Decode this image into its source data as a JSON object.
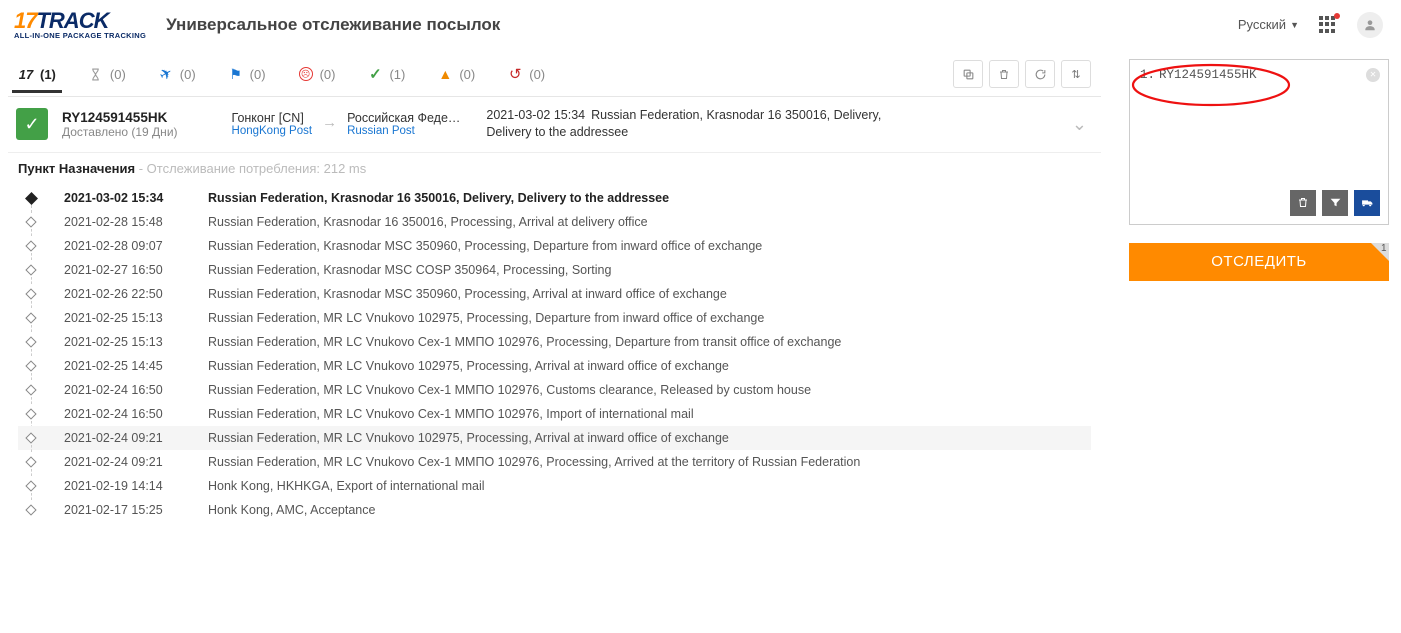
{
  "header": {
    "logo_17": "17",
    "logo_track": "TRACK",
    "logo_sub": "ALL-IN-ONE PACKAGE TRACKING",
    "title": "Универсальное отслеживание посылок",
    "language": "Русский"
  },
  "tabs": {
    "all": "(1)",
    "pending": "(0)",
    "transit": "(0)",
    "flag": "(0)",
    "alert": "(0)",
    "delivered": "(1)",
    "warning": "(0)",
    "returned": "(0)"
  },
  "summary": {
    "tracking_no": "RY124591455HK",
    "status_sub": "Доставлено (19 Дни)",
    "origin_country": "Гонконг [CN]",
    "origin_carrier": "HongKong Post",
    "dest_country": "Российская Феде…",
    "dest_carrier": "Russian Post",
    "latest_dt": "2021-03-02 15:34",
    "latest_text": "Russian Federation, Krasnodar 16 350016, Delivery, Delivery to the addressee"
  },
  "dest": {
    "label": "Пункт Назначения",
    "meta": " - Отслеживание потребления: 212 ms"
  },
  "events": [
    {
      "dt": "2021-03-02 15:34",
      "text": "Russian Federation, Krasnodar 16 350016, Delivery, Delivery to the addressee",
      "first": true
    },
    {
      "dt": "2021-02-28 15:48",
      "text": "Russian Federation, Krasnodar 16 350016, Processing, Arrival at delivery office"
    },
    {
      "dt": "2021-02-28 09:07",
      "text": "Russian Federation, Krasnodar MSC 350960, Processing, Departure from inward office of exchange"
    },
    {
      "dt": "2021-02-27 16:50",
      "text": "Russian Federation, Krasnodar MSC COSP 350964, Processing, Sorting"
    },
    {
      "dt": "2021-02-26 22:50",
      "text": "Russian Federation, Krasnodar MSC 350960, Processing, Arrival at inward office of exchange"
    },
    {
      "dt": "2021-02-25 15:13",
      "text": "Russian Federation, MR LC Vnukovo 102975, Processing, Departure from inward office of exchange"
    },
    {
      "dt": "2021-02-25 15:13",
      "text": "Russian Federation, MR LC Vnukovo Cex-1 ММПО 102976, Processing, Departure from transit office of exchange"
    },
    {
      "dt": "2021-02-25 14:45",
      "text": "Russian Federation, MR LC Vnukovo 102975, Processing, Arrival at inward office of exchange"
    },
    {
      "dt": "2021-02-24 16:50",
      "text": "Russian Federation, MR LC Vnukovo Cex-1 ММПО 102976, Customs clearance, Released by custom house"
    },
    {
      "dt": "2021-02-24 16:50",
      "text": "Russian Federation, MR LC Vnukovo Cex-1 ММПО 102976, Import of international mail"
    },
    {
      "dt": "2021-02-24 09:21",
      "text": "Russian Federation, MR LC Vnukovo 102975, Processing, Arrival at inward office of exchange",
      "hl": true
    },
    {
      "dt": "2021-02-24 09:21",
      "text": "Russian Federation, MR LC Vnukovo Cex-1 ММПО 102976, Processing, Arrived at the territory of Russian Federation"
    },
    {
      "dt": "2021-02-19 14:14",
      "text": "Honk Kong, HKHKGA, Export of international mail"
    },
    {
      "dt": "2021-02-17 15:25",
      "text": "Honk Kong, AMC, Acceptance"
    }
  ],
  "right": {
    "line_no": "1.",
    "tracking": "RY124591455HK",
    "track_button": "ОТСЛЕДИТЬ",
    "corner_count": "1"
  }
}
